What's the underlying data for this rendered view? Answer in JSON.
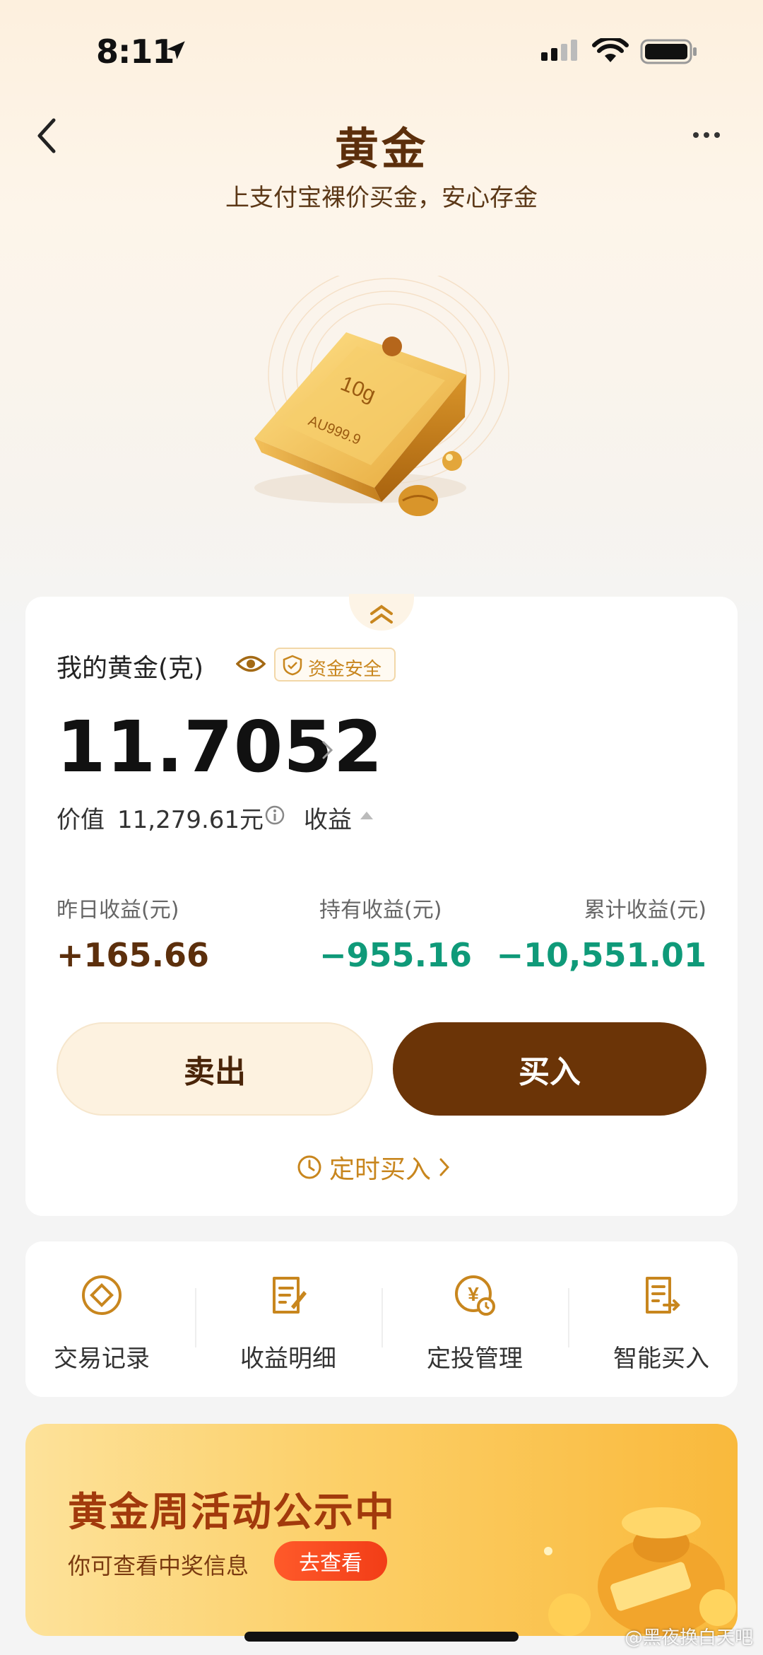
{
  "status_bar": {
    "time": "8:11"
  },
  "header": {
    "title": "黄金",
    "subtitle": "上支付宝裸价买金，安心存金"
  },
  "hero": {
    "bar_weight": "10g",
    "bar_purity": "AU999.9"
  },
  "holdings": {
    "label": "我的黄金(克)",
    "safety_badge": "资金安全",
    "amount": "11.7052",
    "value_label": "价值",
    "value_amount": "11,279.61元",
    "earnings_toggle": "收益"
  },
  "stats": [
    {
      "label": "昨日收益(元)",
      "value": "+165.66"
    },
    {
      "label": "持有收益(元)",
      "value": "−955.16"
    },
    {
      "label": "累计收益(元)",
      "value": "−10,551.01"
    }
  ],
  "actions": {
    "sell": "卖出",
    "buy": "买入",
    "scheduled_buy": "定时买入"
  },
  "menu": [
    {
      "label": "交易记录",
      "icon": "transaction-record-icon"
    },
    {
      "label": "收益明细",
      "icon": "earnings-detail-icon"
    },
    {
      "label": "定投管理",
      "icon": "auto-invest-icon"
    },
    {
      "label": "智能买入",
      "icon": "smart-buy-icon"
    }
  ],
  "banner": {
    "title": "黄金周活动公示中",
    "subtitle": "你可查看中奖信息",
    "button": "去查看"
  },
  "watermark": "@黑夜换白天吧",
  "colors": {
    "brand_brown": "#6b3407",
    "gold_accent": "#c8861e",
    "positive": "#5c2f0c",
    "negative": "#0f9a79"
  }
}
